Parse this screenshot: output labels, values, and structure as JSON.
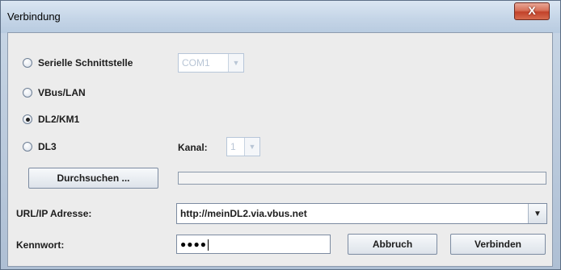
{
  "window": {
    "title": "Verbindung",
    "close_glyph": "X"
  },
  "connection": {
    "serial_label": "Serielle Schnittstelle",
    "serial_port": "COM1",
    "vbus_label": "VBus/LAN",
    "dl2_label": "DL2/KM1",
    "dl3_label": "DL3",
    "kanal_label": "Kanal:",
    "kanal_value": "1",
    "selected": "DL2/KM1"
  },
  "browse_button": "Durchsuchen ...",
  "progress": 0,
  "url": {
    "label": "URL/IP Adresse:",
    "value": "http://meinDL2.via.vbus.net"
  },
  "password": {
    "label": "Kennwort:",
    "masked": "●●●●"
  },
  "buttons": {
    "cancel": "Abbruch",
    "connect": "Verbinden"
  },
  "icons": {
    "close": "close-icon",
    "dropdown": "chevron-down-icon"
  }
}
